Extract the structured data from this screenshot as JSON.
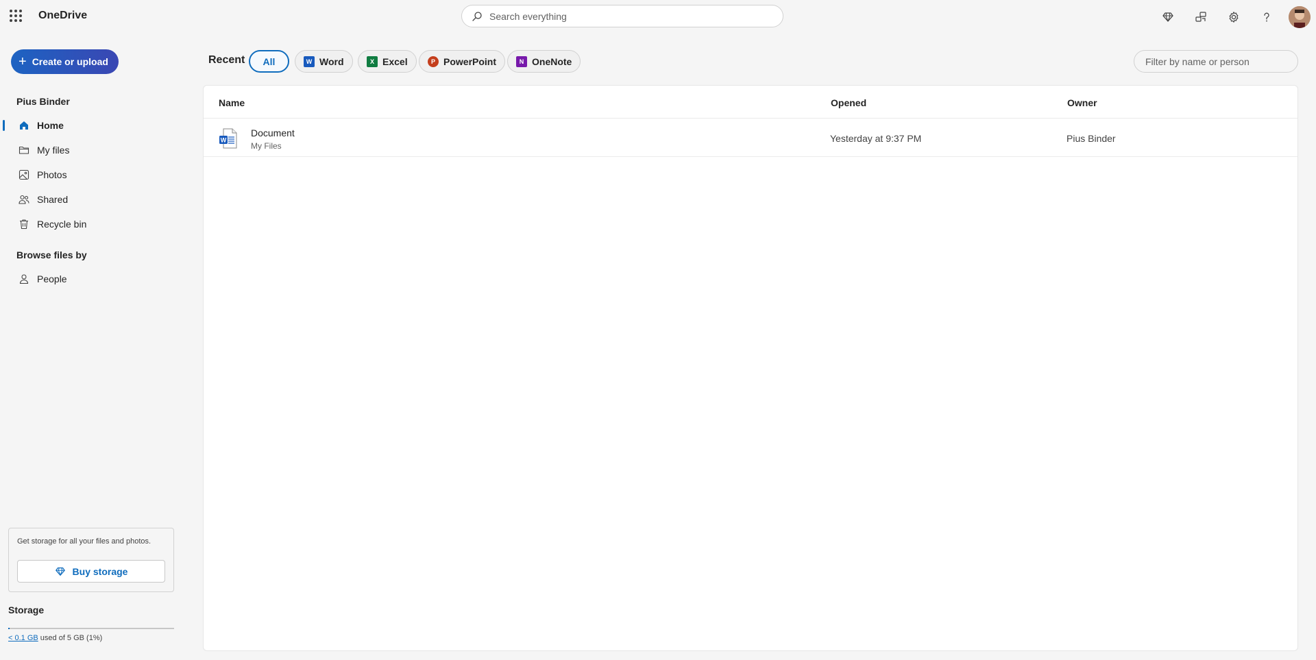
{
  "app": {
    "name": "OneDrive"
  },
  "search": {
    "placeholder": "Search everything"
  },
  "header_icons": [
    "premium-diamond-icon",
    "share-feedback-icon",
    "settings-gear-icon",
    "help-icon",
    "profile-avatar"
  ],
  "sidebar": {
    "create_label": "Create or upload",
    "user_name": "Pius Binder",
    "items": [
      {
        "label": "Home",
        "icon": "home-icon",
        "active": true
      },
      {
        "label": "My files",
        "icon": "folder-icon",
        "active": false
      },
      {
        "label": "Photos",
        "icon": "photo-icon",
        "active": false
      },
      {
        "label": "Shared",
        "icon": "people-shared-icon",
        "active": false
      },
      {
        "label": "Recycle bin",
        "icon": "trash-icon",
        "active": false
      }
    ],
    "browse_title": "Browse files by",
    "browse_items": [
      {
        "label": "People",
        "icon": "person-icon"
      }
    ]
  },
  "storage": {
    "promo_text": "Get storage for all your files and photos.",
    "buy_label": "Buy storage",
    "title": "Storage",
    "used_link": "< 0.1 GB",
    "used_suffix": "used of 5 GB (1%)",
    "used_fraction": 0.01
  },
  "filters": {
    "recent_label": "Recent",
    "pills": [
      {
        "label": "All",
        "selected": true
      },
      {
        "label": "Word",
        "icon": "word-icon",
        "color": "#185abd"
      },
      {
        "label": "Excel",
        "icon": "excel-icon",
        "color": "#107c41"
      },
      {
        "label": "PowerPoint",
        "icon": "powerpoint-icon",
        "color": "#c43e1c"
      },
      {
        "label": "OneNote",
        "icon": "onenote-icon",
        "color": "#7719aa"
      }
    ],
    "filter_placeholder": "Filter by name or person"
  },
  "table": {
    "columns": [
      "Name",
      "Opened",
      "Owner"
    ],
    "rows": [
      {
        "name": "Document",
        "location": "My Files",
        "opened": "Yesterday at 9:37 PM",
        "owner": "Pius Binder",
        "icon": "word-document-icon"
      }
    ]
  },
  "colors": {
    "accent": "#0f6cbd",
    "word": "#185abd",
    "excel": "#107c41",
    "powerpoint": "#c43e1c",
    "onenote": "#7719aa"
  }
}
